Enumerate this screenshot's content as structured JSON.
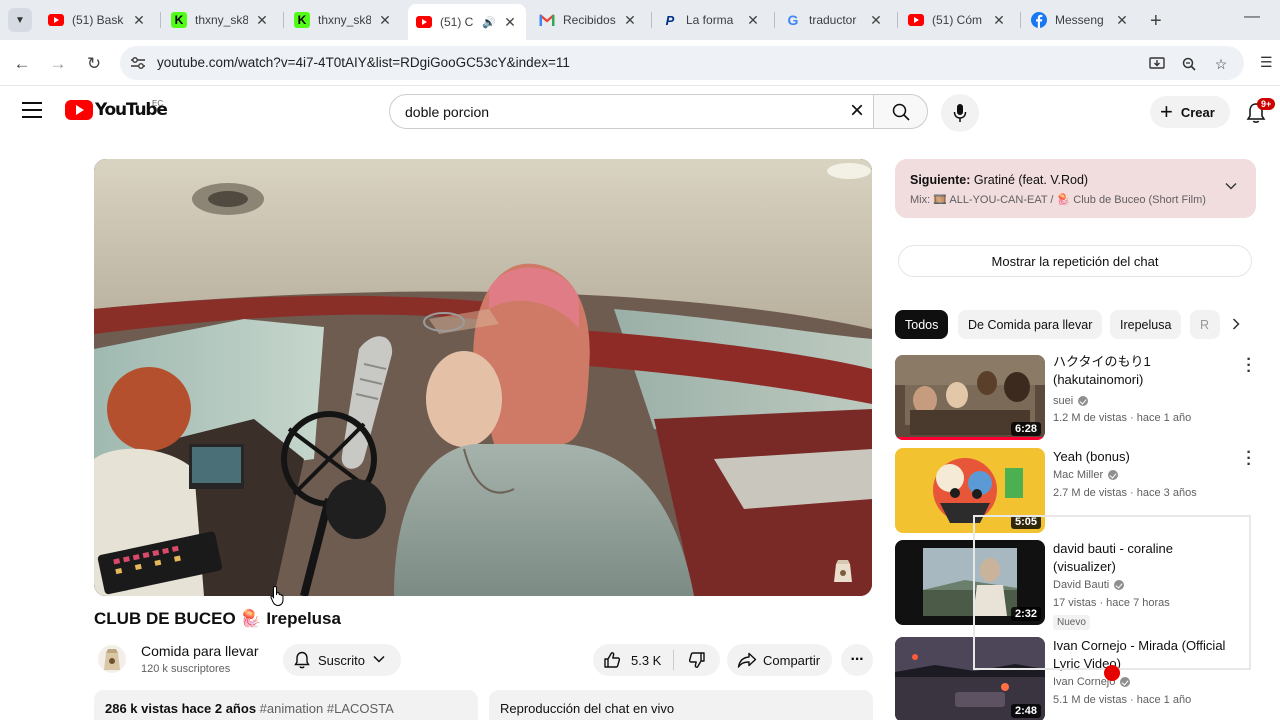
{
  "browser": {
    "tabs": [
      {
        "title": "(51) Bask",
        "favicon": "youtube-icon"
      },
      {
        "title": "thxny_sk8",
        "favicon": "kick-icon"
      },
      {
        "title": "thxny_sk8",
        "favicon": "kick-icon"
      },
      {
        "title": "(51) C",
        "favicon": "youtube-icon",
        "active": true
      },
      {
        "title": "Recibidos",
        "favicon": "gmail-icon"
      },
      {
        "title": "La forma",
        "favicon": "paypal-icon"
      },
      {
        "title": "traductor",
        "favicon": "google-icon"
      },
      {
        "title": "(51) Cóm",
        "favicon": "youtube-icon"
      },
      {
        "title": "Messeng",
        "favicon": "facebook-icon"
      }
    ],
    "url": "youtube.com/watch?v=4i7-4T0tAIY&list=RDgiGooGC53cY&index=11"
  },
  "masthead": {
    "logo_text": "YouTube",
    "region": "EC",
    "search_value": "doble porcion",
    "create_label": "Crear",
    "notifications_badge": "9+"
  },
  "video": {
    "title": "CLUB DE BUCEO",
    "title_emoji": "🪼",
    "title_artist": "Irepelusa",
    "channel_name": "Comida para llevar",
    "subscribers": "120 k suscriptores",
    "subscribed_label": "Suscrito",
    "likes": "5.3 K",
    "share_label": "Compartir",
    "description_stats": "286 k vistas  hace 2 años",
    "description_tags": "#animation #LACOSTA",
    "chat_replay_label": "Reproducción del chat en vivo"
  },
  "sidebar": {
    "upnext_label": "Siguiente:",
    "upnext_title": "Gratiné (feat. V.Rod)",
    "upnext_mix": "Mix: 🎞️ ALL-YOU-CAN-EAT / 🪼 Club de Buceo (Short Film)",
    "show_chat_replay": "Mostrar la repetición del chat",
    "chips": [
      "Todos",
      "De Comida para llevar",
      "Irepelusa",
      "R"
    ],
    "recommendations": [
      {
        "title": "ハクタイのもり1 (hakutainomori)",
        "channel": "suei",
        "verified": true,
        "meta": "1.2 M de vistas · hace 1 año",
        "duration": "6:28",
        "progress": 1.0
      },
      {
        "title": "Yeah (bonus)",
        "channel": "Mac Miller",
        "verified": true,
        "meta": "2.7 M de vistas · hace 3 años",
        "duration": "5:05",
        "progress": 0
      },
      {
        "title": "david bauti - coraline (visualizer)",
        "channel": "David Bauti",
        "verified": true,
        "meta": "17 vistas · hace 7 horas",
        "badge": "Nuevo",
        "duration": "2:32",
        "progress": 0
      },
      {
        "title": "Ivan Cornejo - Mirada (Official Lyric Video)",
        "channel": "Ivan Cornejo",
        "verified": true,
        "meta": "5.1 M de vistas · hace 1 año",
        "duration": "2:48",
        "progress": 0
      }
    ]
  },
  "colors": {
    "youtube_red": "#ff0000",
    "upnext_bg": "#f1dcde",
    "chip_active": "#0f0f0f",
    "progress_red": "#ff0033"
  }
}
